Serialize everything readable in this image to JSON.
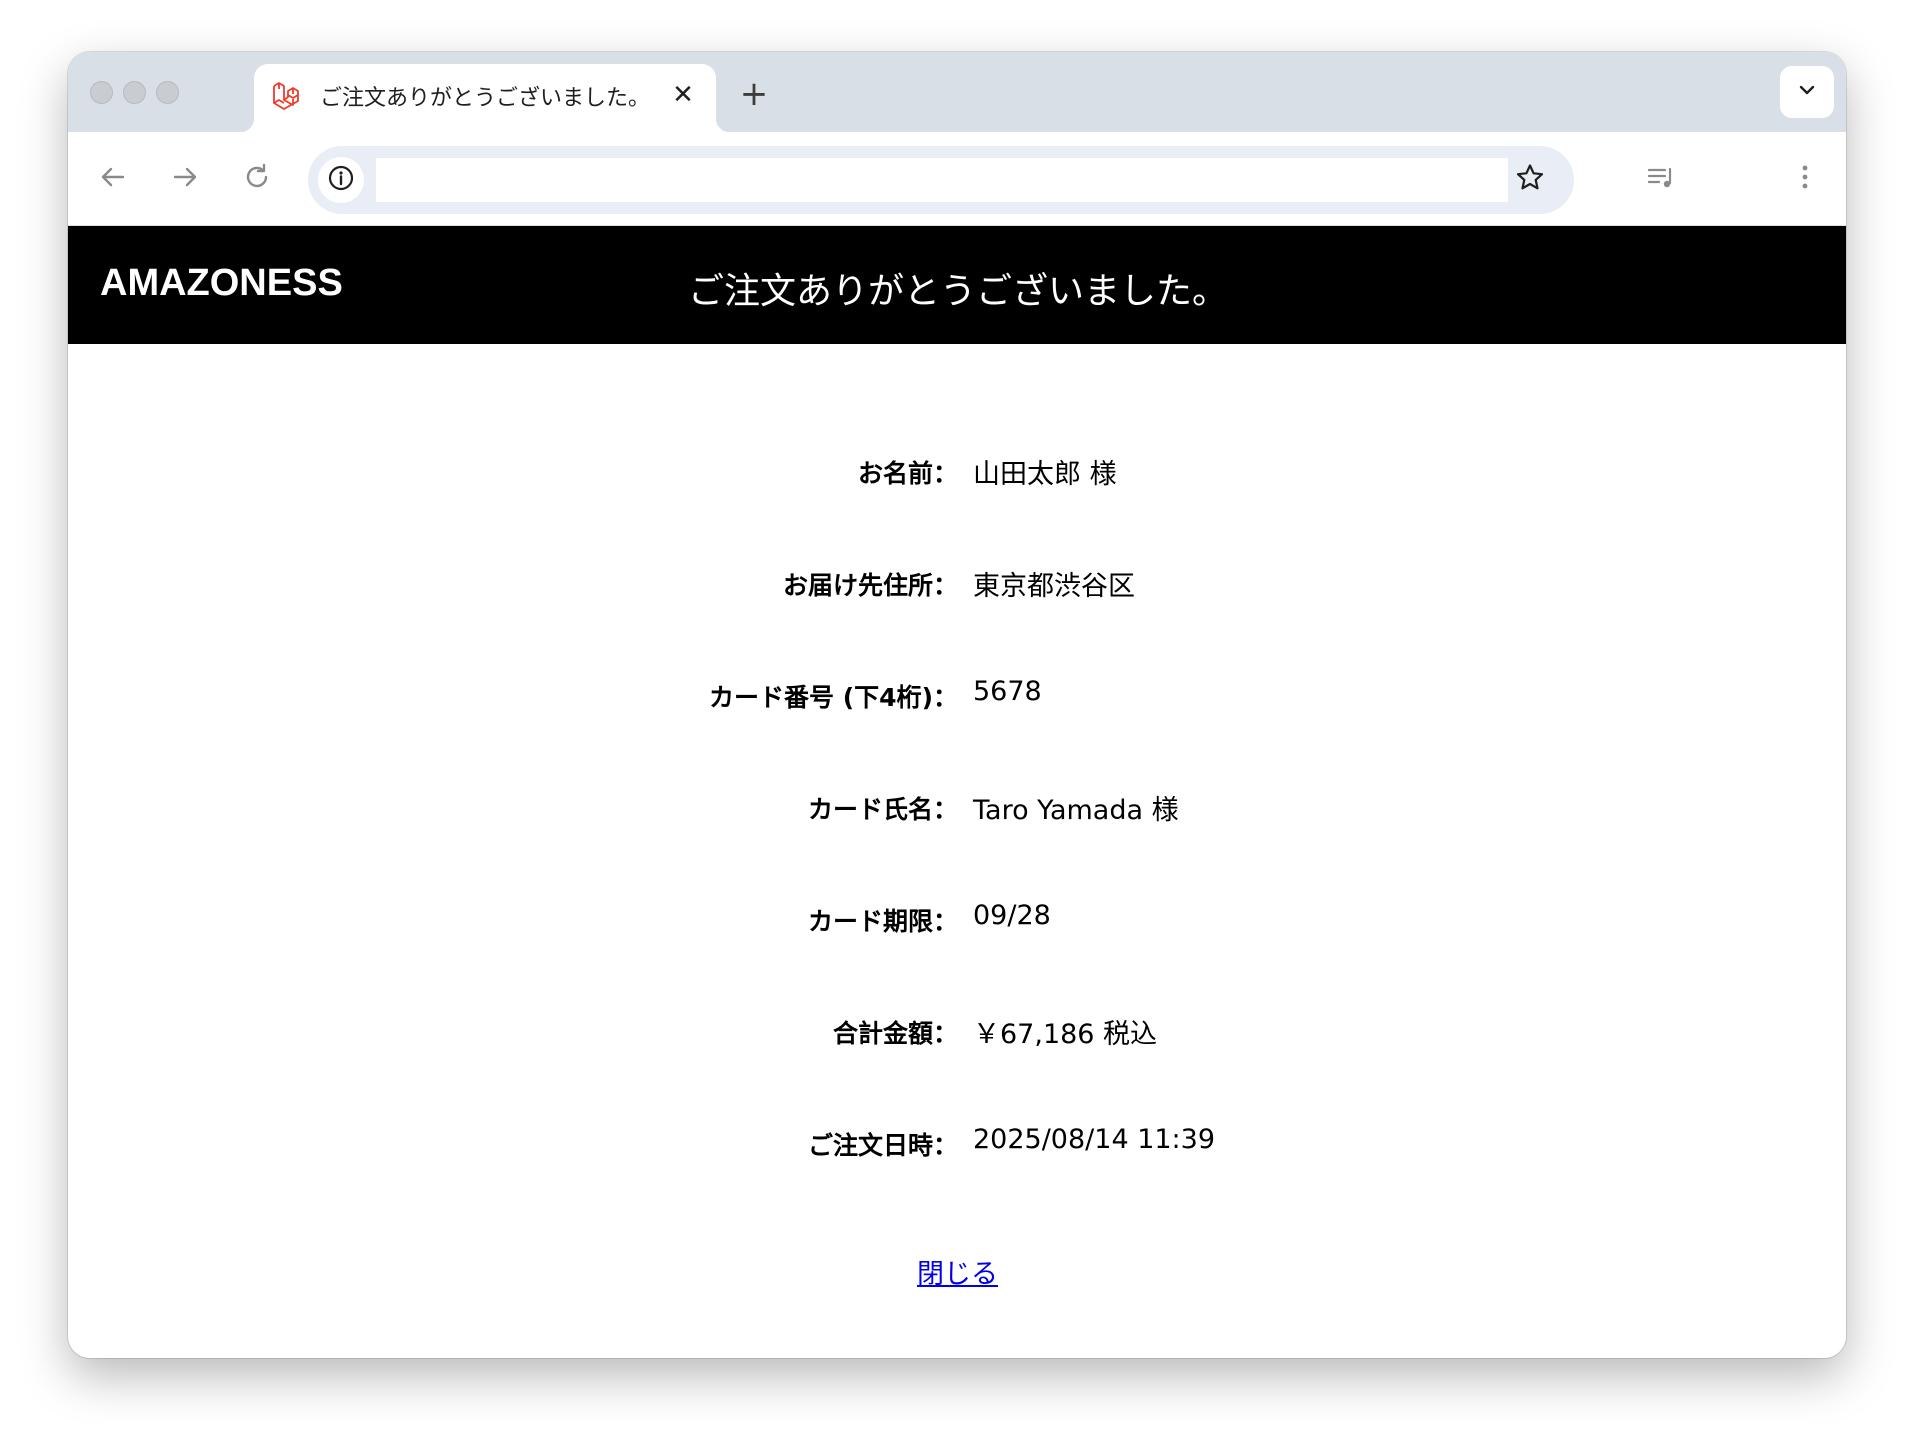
{
  "browser": {
    "tab_title": "ご注文ありがとうございました。",
    "tab_close_glyph": "✕",
    "new_tab_glyph": "+",
    "url_value": ""
  },
  "header": {
    "brand": "AMAZONESS",
    "title": "ご注文ありがとうございました。"
  },
  "order": {
    "rows": [
      {
        "label": "お名前：",
        "value": "山田太郎 様"
      },
      {
        "label": "お届け先住所：",
        "value": "東京都渋谷区"
      },
      {
        "label": "カード番号 (下4桁)：",
        "value": "5678"
      },
      {
        "label": "カード氏名：",
        "value": "Taro Yamada 様"
      },
      {
        "label": "カード期限：",
        "value": "09/28"
      },
      {
        "label": "合計金額：",
        "value": "￥67,186 税込"
      },
      {
        "label": "ご注文日時：",
        "value": "2025/08/14 11:39"
      }
    ],
    "close_link": "閉じる"
  },
  "colors": {
    "header_bg": "#000000",
    "tabstrip_bg": "#d9dfe7",
    "omnibox_bg": "#e9eef6",
    "link": "#0000ee",
    "favicon": "#ef3b2d"
  },
  "icons": {
    "favicon": "laravel-icon",
    "back": "arrow-left-icon",
    "forward": "arrow-right-icon",
    "reload": "reload-icon",
    "info": "info-icon",
    "bookmark": "star-icon",
    "media": "media-queue-icon",
    "menu": "more-vertical-icon",
    "tab_list": "chevron-down-icon"
  }
}
